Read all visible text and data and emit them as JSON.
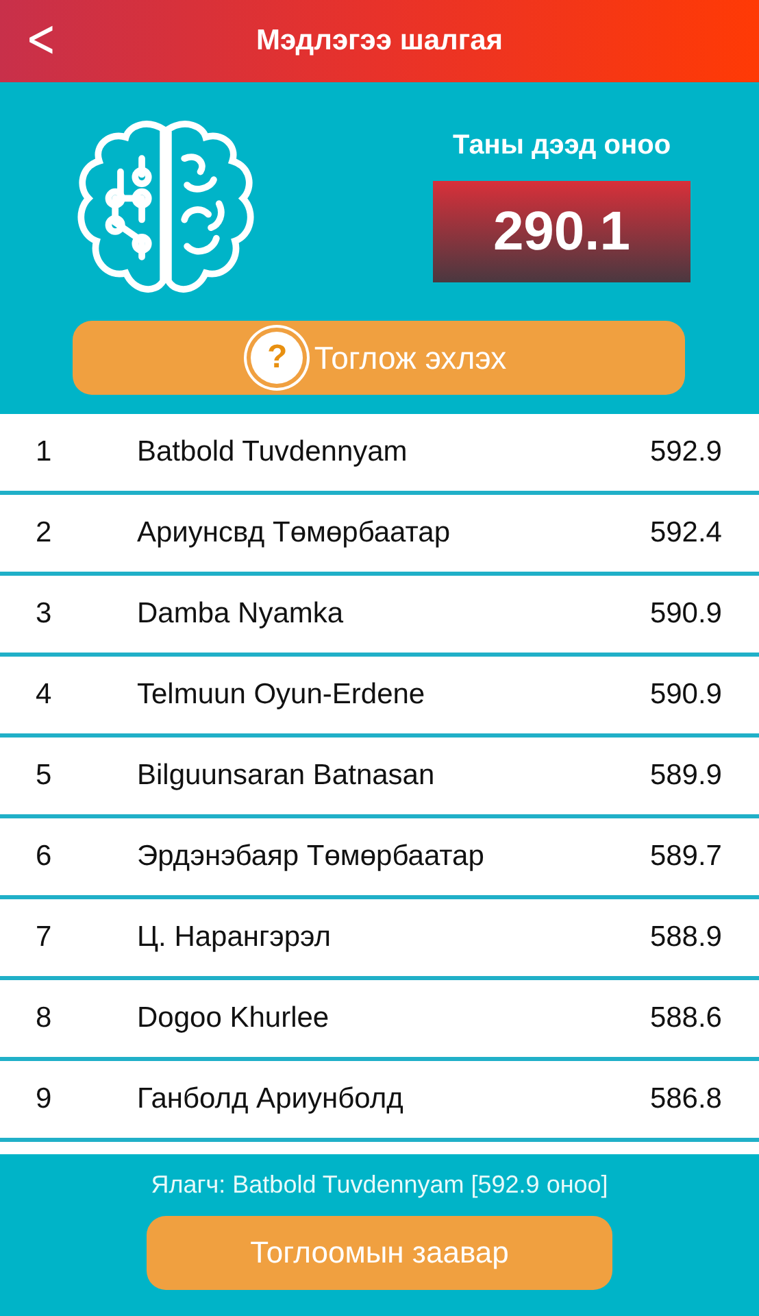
{
  "header": {
    "back": "<",
    "title": "Мэдлэгээ шалгая"
  },
  "best": {
    "label": "Таны дээд оноо",
    "score": "290.1"
  },
  "start_button": {
    "icon": "?",
    "label": "Тоглож эхлэх"
  },
  "leaderboard": [
    {
      "rank": "1",
      "name": "Batbold Tuvdennyam",
      "score": "592.9"
    },
    {
      "rank": "2",
      "name": "Ариунсвд Төмөрбаатар",
      "score": "592.4"
    },
    {
      "rank": "3",
      "name": "Damba Nyamka",
      "score": "590.9"
    },
    {
      "rank": "4",
      "name": "Telmuun Oyun-Erdene",
      "score": "590.9"
    },
    {
      "rank": "5",
      "name": "Bilguunsaran Batnasan",
      "score": "589.9"
    },
    {
      "rank": "6",
      "name": "Эрдэнэбаяр Төмөрбаатар",
      "score": "589.7"
    },
    {
      "rank": "7",
      "name": "Ц. Нарангэрэл",
      "score": "588.9"
    },
    {
      "rank": "8",
      "name": "Dogoo Khurlee",
      "score": "588.6"
    },
    {
      "rank": "9",
      "name": "Ганболд Ариунболд",
      "score": "586.8"
    }
  ],
  "footer": {
    "winner": "Ялагч: Batbold Tuvdennyam [592.9 оноо]",
    "button": "Тоглоомын заавар"
  }
}
